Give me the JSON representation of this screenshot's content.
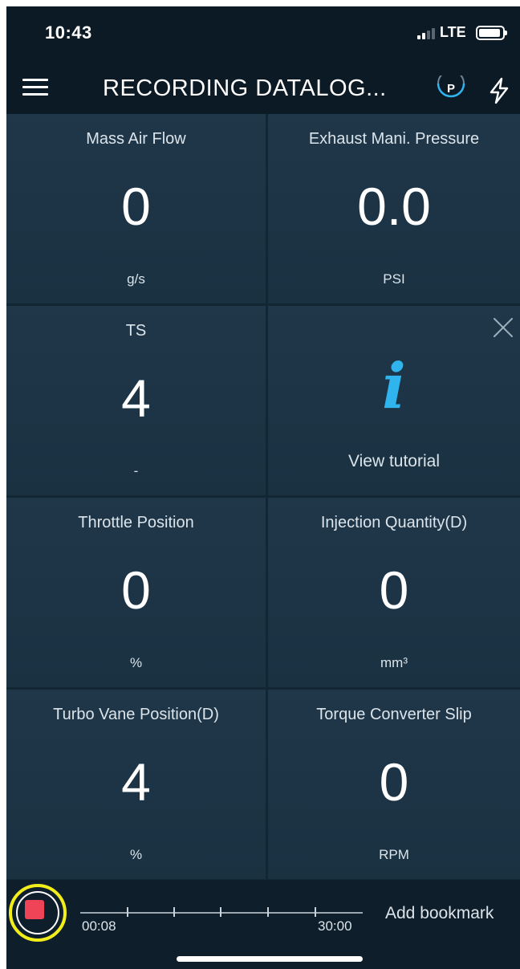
{
  "status_bar": {
    "time": "10:43",
    "network": "LTE"
  },
  "app_bar": {
    "menu_icon": "hamburger-menu-icon",
    "title": "RECORDING DATALOG...",
    "badge_letter": "P",
    "badge_color": "#2fb4ee",
    "action_icon": "lightning-bolt-icon"
  },
  "tiles": [
    {
      "label": "Mass Air Flow",
      "value": "0",
      "unit": "g/s"
    },
    {
      "label": "Exhaust Mani. Pressure",
      "value": "0.0",
      "unit": "PSI"
    },
    {
      "label": "TS",
      "value": "4",
      "unit": "-"
    },
    {
      "label": "Throttle Position",
      "value": "0",
      "unit": "%"
    },
    {
      "label": "Injection Quantity(D)",
      "value": "0",
      "unit": "mm³"
    },
    {
      "label": "Turbo Vane Position(D)",
      "value": "4",
      "unit": "%"
    },
    {
      "label": "Torque Converter Slip",
      "value": "0",
      "unit": "RPM"
    }
  ],
  "tutorial": {
    "info_glyph": "i",
    "label": "View tutorial",
    "close_icon": "close-icon",
    "accent_color": "#2fb4ee"
  },
  "recording": {
    "stop_color": "#ef4357",
    "highlight_color": "#f2ee1c",
    "elapsed": "00:08",
    "duration": "30:00",
    "bookmark_label": "Add bookmark"
  }
}
